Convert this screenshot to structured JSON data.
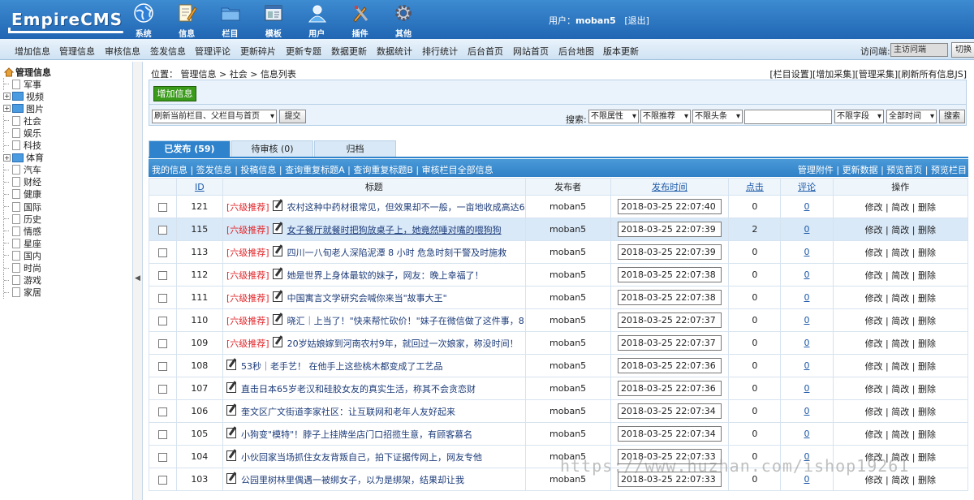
{
  "header": {
    "logo_text": "EmpireCMS",
    "nav": [
      {
        "label": "系统",
        "icon": "globe-icon"
      },
      {
        "label": "信息",
        "icon": "edit-document-icon"
      },
      {
        "label": "栏目",
        "icon": "folder-icon"
      },
      {
        "label": "模板",
        "icon": "template-window-icon"
      },
      {
        "label": "用户",
        "icon": "user-icon"
      },
      {
        "label": "插件",
        "icon": "tools-icon"
      },
      {
        "label": "其他",
        "icon": "gear-icon"
      }
    ],
    "user_prefix": "用户：",
    "username": "moban5",
    "logout": "[退出]"
  },
  "menubar": {
    "items": [
      "增加信息",
      "管理信息",
      "审核信息",
      "签发信息",
      "管理评论",
      "更新碎片",
      "更新专题",
      "数据更新",
      "数据统计",
      "排行统计",
      "后台首页",
      "网站首页",
      "后台地图",
      "版本更新"
    ],
    "visitor_label": "访问端:",
    "visitor_value": "主访问端",
    "switch_label": "切换"
  },
  "tree": {
    "root": "管理信息",
    "nodes": [
      {
        "label": "军事",
        "type": "doc"
      },
      {
        "label": "视频",
        "type": "folder"
      },
      {
        "label": "图片",
        "type": "folder"
      },
      {
        "label": "社会",
        "type": "doc"
      },
      {
        "label": "娱乐",
        "type": "doc"
      },
      {
        "label": "科技",
        "type": "doc"
      },
      {
        "label": "体育",
        "type": "folder"
      },
      {
        "label": "汽车",
        "type": "doc"
      },
      {
        "label": "财经",
        "type": "doc"
      },
      {
        "label": "健康",
        "type": "doc"
      },
      {
        "label": "国际",
        "type": "doc"
      },
      {
        "label": "历史",
        "type": "doc"
      },
      {
        "label": "情感",
        "type": "doc"
      },
      {
        "label": "星座",
        "type": "doc"
      },
      {
        "label": "国内",
        "type": "doc"
      },
      {
        "label": "时尚",
        "type": "doc"
      },
      {
        "label": "游戏",
        "type": "doc"
      },
      {
        "label": "家居",
        "type": "doc"
      }
    ]
  },
  "main": {
    "location_prefix": "位置：",
    "location": [
      "管理信息",
      "社会",
      "信息列表"
    ],
    "location_sep": " > ",
    "top_links": [
      "[栏目设置]",
      "[增加采集]",
      "[管理采集]",
      "[刷新所有信息JS]"
    ],
    "add_button": "增加信息",
    "refresh_select": "刷新当前栏目、父栏目与首页",
    "submit_button": "提交",
    "search_label": "搜索:",
    "filters": [
      "不限属性",
      "不限推荐",
      "不限头条",
      "不限字段",
      "全部时间"
    ],
    "search_button": "搜索",
    "tabs": [
      "已发布 (59)",
      "待审核 (0)",
      "归档"
    ],
    "sub_links_left": "我的信息 | 签发信息 | 投稿信息 | 查询重复标题A | 查询重复标题B | 审核栏目全部信息",
    "sub_links_right": "管理附件 | 更新数据 | 预览首页 | 预览栏目",
    "columns": {
      "id": "ID",
      "title": "标题",
      "publisher": "发布者",
      "time": "发布时间",
      "clicks": "点击",
      "comments": "评论",
      "ops": "操作"
    },
    "op_labels": "修改 | 简改 | 删除",
    "rows": [
      {
        "id": "121",
        "tag": "[六级推荐]",
        "title": "农村这种中药材很常见，但效果却不一般，一亩地收成高达6",
        "publisher": "moban5",
        "time": "2018-03-25 22:07:40",
        "clicks": "0",
        "comments": "0"
      },
      {
        "id": "115",
        "tag": "[六级推荐]",
        "title": "女子餐厅就餐时把狗放桌子上，她竟然唾对嘴的喂狗狗",
        "publisher": "moban5",
        "time": "2018-03-25 22:07:39",
        "clicks": "2",
        "comments": "0"
      },
      {
        "id": "113",
        "tag": "[六级推荐]",
        "title": "四川一八旬老人深陷泥潭 8 小时 危急时刻干警及时施救",
        "publisher": "moban5",
        "time": "2018-03-25 22:07:39",
        "clicks": "0",
        "comments": "0"
      },
      {
        "id": "112",
        "tag": "[六级推荐]",
        "title": "她是世界上身体最软的妹子，网友：晚上幸福了！",
        "publisher": "moban5",
        "time": "2018-03-25 22:07:38",
        "clicks": "0",
        "comments": "0"
      },
      {
        "id": "111",
        "tag": "[六级推荐]",
        "title": "中国寓言文学研究会喊你来当\"故事大王\"",
        "publisher": "moban5",
        "time": "2018-03-25 22:07:38",
        "clicks": "0",
        "comments": "0"
      },
      {
        "id": "110",
        "tag": "[六级推荐]",
        "title": "晓汇｜上当了！\"快来帮忙砍价！\"妹子在微信做了这件事，8",
        "publisher": "moban5",
        "time": "2018-03-25 22:07:37",
        "clicks": "0",
        "comments": "0"
      },
      {
        "id": "109",
        "tag": "[六级推荐]",
        "title": "20岁姑娘嫁到河南农村9年，就回过一次娘家，称没时间！",
        "publisher": "moban5",
        "time": "2018-03-25 22:07:37",
        "clicks": "0",
        "comments": "0"
      },
      {
        "id": "108",
        "tag": "",
        "title": "53秒｜老手艺！ 在他手上这些桃木都变成了工艺品",
        "publisher": "moban5",
        "time": "2018-03-25 22:07:36",
        "clicks": "0",
        "comments": "0"
      },
      {
        "id": "107",
        "tag": "",
        "title": "直击日本65岁老汉和硅胶女友的真实生活，称其不会贪恋财",
        "publisher": "moban5",
        "time": "2018-03-25 22:07:36",
        "clicks": "0",
        "comments": "0"
      },
      {
        "id": "106",
        "tag": "",
        "title": "奎文区广文街道李家社区：让互联网和老年人友好起来",
        "publisher": "moban5",
        "time": "2018-03-25 22:07:34",
        "clicks": "0",
        "comments": "0"
      },
      {
        "id": "105",
        "tag": "",
        "title": "小狗变\"模特\"！脖子上挂牌坐店门口招揽生意，有顾客慕名",
        "publisher": "moban5",
        "time": "2018-03-25 22:07:34",
        "clicks": "0",
        "comments": "0"
      },
      {
        "id": "104",
        "tag": "",
        "title": "小伙回家当场抓住女友背叛自己，拍下证据传网上，网友专他",
        "publisher": "moban5",
        "time": "2018-03-25 22:07:33",
        "clicks": "0",
        "comments": "0"
      },
      {
        "id": "103",
        "tag": "",
        "title": "公园里树林里偶遇一被绑女子，以为是绑架，结果却让我",
        "publisher": "moban5",
        "time": "2018-03-25 22:07:33",
        "clicks": "0",
        "comments": "0"
      }
    ]
  },
  "watermark": "https://www.huzhan.com/ishop19261"
}
